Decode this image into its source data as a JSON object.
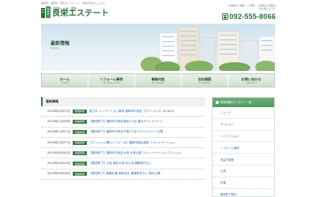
{
  "header": {
    "tagline": "福岡県、福岡市、南区のリフォーム、不動産売買のことなら",
    "logo_sub": "不動産・土地・建物",
    "logo_name": "良栄エステート",
    "contact_note_1": "お電話のご相談・ご質問・ご訪問のご依頼は",
    "contact_note_2": "お気軽にどうぞ",
    "phone": "092-555-8066"
  },
  "hero": {
    "title": "最新情報",
    "sub": "NEWS"
  },
  "nav": [
    {
      "jp": "ホーム",
      "en": "HOME"
    },
    {
      "jp": "リフォーム事例",
      "en": "REFORM CASE"
    },
    {
      "jp": "事業内容",
      "en": "BUSINESS"
    },
    {
      "jp": "会社概要",
      "en": "COMPANY"
    },
    {
      "jp": "お問い合わせ",
      "en": "CONTACT"
    }
  ],
  "news": {
    "heading": "最新情報",
    "items": [
      {
        "date": "2016年01月13日",
        "badge": "新着情報",
        "title": "施工中 リノベーション事例 福岡市中央区【マンション】 81.60㎡"
      },
      {
        "date": "2014年12月26日",
        "badge": "新着情報",
        "title": "【販売終了】福岡市中央区清水4丁目 清水グランドコート"
      },
      {
        "date": "2014年11月21日",
        "badge": "新着情報",
        "title": "【販売終了】福岡市中央区平尾2丁目 グランドコート平尾"
      },
      {
        "date": "2014年10月27日",
        "badge": "新着情報",
        "title": "【マンション購入リフォーム】福岡市南区高宮 フルリノベーション"
      },
      {
        "date": "2014年05月02日",
        "badge": "新着情報",
        "title": "【販売終了】福岡市中央区大濠 大濠公園 フルリノベーションマンション"
      },
      {
        "date": "2014年04月10日",
        "badge": "新着情報",
        "title": "【販売終了】土地 南区大池 売土地 建築条件なし"
      },
      {
        "date": "2014年03月18日",
        "badge": "新着情報",
        "title": "【販売終了】新築戸建 南区若久 建築条件なし 物件公開"
      }
    ]
  },
  "sidebar": {
    "heading": "物件情報カテゴリー一覧",
    "items": [
      "ニュース",
      "マンション",
      "リノベーション",
      "リフォーム事例",
      "収益不動産",
      "土地",
      "戸建",
      "販売終了物件"
    ]
  },
  "colors": {
    "brand_green": "#3b7c47",
    "link_blue": "#2a63a8"
  }
}
